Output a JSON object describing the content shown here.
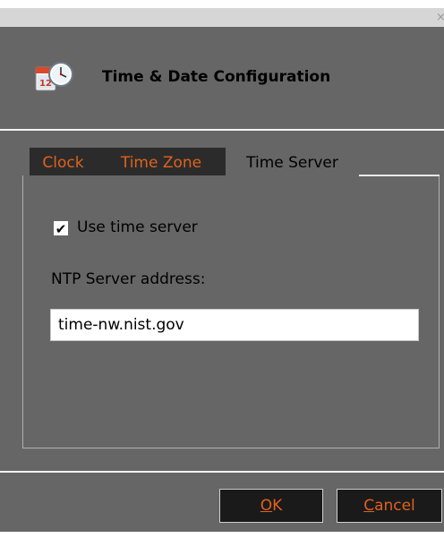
{
  "window": {
    "close_glyph": "×"
  },
  "header": {
    "title": "Time & Date Configuration",
    "icon": "calendar-clock-icon",
    "icon_day": "12"
  },
  "tabs": [
    {
      "label": "Clock",
      "active": false
    },
    {
      "label": "Time Zone",
      "active": false
    },
    {
      "label": "Time Server",
      "active": true
    }
  ],
  "time_server": {
    "use_time_server_label": "Use time server",
    "use_time_server_checked": true,
    "check_glyph": "✔",
    "ntp_label": "NTP Server address:",
    "ntp_value": "time-nw.nist.gov"
  },
  "footer": {
    "ok_mnemonic": "O",
    "ok_rest": "K",
    "cancel_mnemonic": "C",
    "cancel_rest": "ancel"
  },
  "colors": {
    "background": "#666666",
    "accent": "#e0621d",
    "tab_inactive_bg": "#2b2b2b",
    "button_bg": "#1a1a1a"
  }
}
